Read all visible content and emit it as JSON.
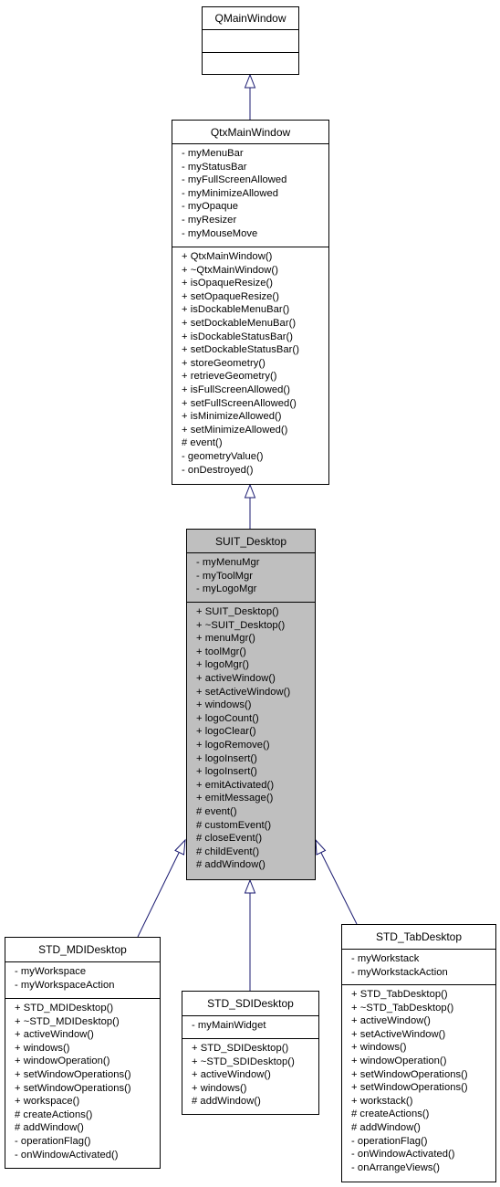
{
  "diagram": {
    "type": "uml-class-inheritance",
    "highlighted_class": "SUIT_Desktop",
    "edge_color": "#191970",
    "highlight_color": "#bfbfbf",
    "classes": {
      "qmainwindow": {
        "name": "QMainWindow",
        "attributes": [],
        "methods": []
      },
      "qtxmainwindow": {
        "name": "QtxMainWindow",
        "attributes": [
          "- myMenuBar",
          "- myStatusBar",
          "- myFullScreenAllowed",
          "- myMinimizeAllowed",
          "- myOpaque",
          "- myResizer",
          "- myMouseMove"
        ],
        "methods": [
          "+ QtxMainWindow()",
          "+ ~QtxMainWindow()",
          "+ isOpaqueResize()",
          "+ setOpaqueResize()",
          "+ isDockableMenuBar()",
          "+ setDockableMenuBar()",
          "+ isDockableStatusBar()",
          "+ setDockableStatusBar()",
          "+ storeGeometry()",
          "+ retrieveGeometry()",
          "+ isFullScreenAllowed()",
          "+ setFullScreenAllowed()",
          "+ isMinimizeAllowed()",
          "+ setMinimizeAllowed()",
          "# event()",
          "- geometryValue()",
          "- onDestroyed()"
        ]
      },
      "suit_desktop": {
        "name": "SUIT_Desktop",
        "attributes": [
          "- myMenuMgr",
          "- myToolMgr",
          "- myLogoMgr"
        ],
        "methods": [
          "+ SUIT_Desktop()",
          "+ ~SUIT_Desktop()",
          "+ menuMgr()",
          "+ toolMgr()",
          "+ logoMgr()",
          "+ activeWindow()",
          "+ setActiveWindow()",
          "+ windows()",
          "+ logoCount()",
          "+ logoClear()",
          "+ logoRemove()",
          "+ logoInsert()",
          "+ logoInsert()",
          "+ emitActivated()",
          "+ emitMessage()",
          "# event()",
          "# customEvent()",
          "# closeEvent()",
          "# childEvent()",
          "# addWindow()"
        ]
      },
      "std_mdidesktop": {
        "name": "STD_MDIDesktop",
        "attributes": [
          "- myWorkspace",
          "- myWorkspaceAction"
        ],
        "methods": [
          "+ STD_MDIDesktop()",
          "+ ~STD_MDIDesktop()",
          "+ activeWindow()",
          "+ windows()",
          "+ windowOperation()",
          "+ setWindowOperations()",
          "+ setWindowOperations()",
          "+ workspace()",
          "# createActions()",
          "# addWindow()",
          "- operationFlag()",
          "- onWindowActivated()"
        ]
      },
      "std_sdidesktop": {
        "name": "STD_SDIDesktop",
        "attributes": [
          "- myMainWidget"
        ],
        "methods": [
          "+ STD_SDIDesktop()",
          "+ ~STD_SDIDesktop()",
          "+ activeWindow()",
          "+ windows()",
          "# addWindow()"
        ]
      },
      "std_tabdesktop": {
        "name": "STD_TabDesktop",
        "attributes": [
          "- myWorkstack",
          "- myWorkstackAction"
        ],
        "methods": [
          "+ STD_TabDesktop()",
          "+ ~STD_TabDesktop()",
          "+ activeWindow()",
          "+ setActiveWindow()",
          "+ windows()",
          "+ windowOperation()",
          "+ setWindowOperations()",
          "+ setWindowOperations()",
          "+ workstack()",
          "# createActions()",
          "# addWindow()",
          "- operationFlag()",
          "- onWindowActivated()",
          "- onArrangeViews()"
        ]
      }
    },
    "inheritance": [
      {
        "child": "QtxMainWindow",
        "parent": "QMainWindow"
      },
      {
        "child": "SUIT_Desktop",
        "parent": "QtxMainWindow"
      },
      {
        "child": "STD_MDIDesktop",
        "parent": "SUIT_Desktop"
      },
      {
        "child": "STD_SDIDesktop",
        "parent": "SUIT_Desktop"
      },
      {
        "child": "STD_TabDesktop",
        "parent": "SUIT_Desktop"
      }
    ]
  }
}
